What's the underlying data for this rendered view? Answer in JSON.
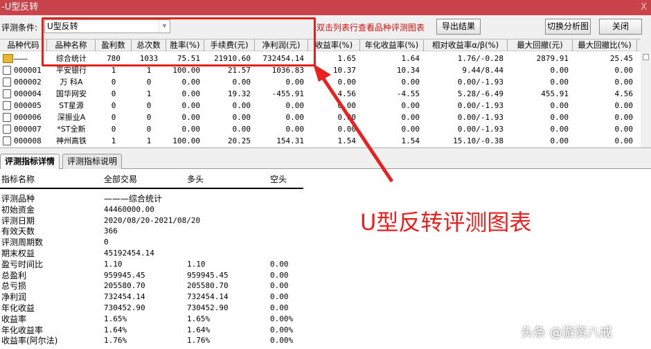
{
  "window": {
    "title": "-U型反转",
    "close": "X"
  },
  "toolbar": {
    "condition_label": "评测条件:",
    "condition_value": "U型反转",
    "hint": "双击列表行查看品种评测图表",
    "export": "导出结果",
    "switch": "切换分析图",
    "close": "关闭"
  },
  "table": {
    "headers": [
      "品种代码",
      "品种名称",
      "盈利数",
      "总次数",
      "胜率(%)",
      "手续费(元)",
      "净利润(元)",
      "收益率(%)",
      "年化收益率(%)",
      "相对收益率α/β(%)",
      "最大回撤(元)",
      "最大回撤比(%)"
    ],
    "rows": [
      [
        "———",
        "综合统计",
        "780",
        "1033",
        "75.51",
        "21910.60",
        "732454.14",
        "1.65",
        "1.64",
        "1.76/-0.28",
        "2879.91",
        "25.45"
      ],
      [
        "000001",
        "平安银行",
        "1",
        "1",
        "100.00",
        "21.57",
        "1036.83",
        "10.37",
        "10.34",
        "9.44/8.44",
        "0.00",
        "0.00"
      ],
      [
        "000002",
        "万 科A",
        "0",
        "0",
        "0.00",
        "0.00",
        "0.00",
        "0.00",
        "0.00",
        "0.00/-1.93",
        "0.00",
        "0.00"
      ],
      [
        "000004",
        "国华网安",
        "0",
        "1",
        "0.00",
        "19.32",
        "-455.91",
        "-4.56",
        "-4.55",
        "5.28/-6.49",
        "455.91",
        "4.56"
      ],
      [
        "000005",
        "ST星源",
        "0",
        "0",
        "0.00",
        "0.00",
        "0.00",
        "0.00",
        "0.00",
        "0.00/-1.93",
        "0.00",
        "0.00"
      ],
      [
        "000006",
        "深振业A",
        "0",
        "0",
        "0.00",
        "0.00",
        "0.00",
        "0.00",
        "0.00",
        "0.00/-1.93",
        "0.00",
        "0.00"
      ],
      [
        "000007",
        "*ST全新",
        "0",
        "0",
        "0.00",
        "0.00",
        "0.00",
        "0.00",
        "0.00",
        "0.00/-1.93",
        "0.00",
        "0.00"
      ],
      [
        "000008",
        "神州高铁",
        "1",
        "1",
        "100.00",
        "20.25",
        "154.31",
        "1.54",
        "1.54",
        "15.10/-0.38",
        "0.00",
        "0.00"
      ]
    ]
  },
  "tabs": [
    "评测指标详情",
    "评测指标说明"
  ],
  "detail": {
    "headers": [
      "指标名称",
      "全部交易",
      "多头",
      "空头"
    ],
    "rows": [
      [
        "评测品种",
        "———综合统计",
        "",
        ""
      ],
      [
        "初始资金",
        "44460000.00",
        "",
        ""
      ],
      [
        "评测日期",
        "2020/08/20-2021/08/20",
        "",
        ""
      ],
      [
        "有效天数",
        "366",
        "",
        ""
      ],
      [
        "评测周期数",
        "0",
        "",
        ""
      ],
      [
        "期末权益",
        "45192454.14",
        "",
        ""
      ],
      [
        "盈亏时间比",
        "1.10",
        "1.10",
        "0.00"
      ],
      [
        "总盈利",
        "959945.45",
        "959945.45",
        "0.00"
      ],
      [
        "总亏损",
        "205580.70",
        "205580.70",
        "0.00"
      ],
      [
        "净利润",
        "732454.14",
        "732454.14",
        "0.00"
      ],
      [
        "年化收益",
        "730452.90",
        "730452.90",
        "0.00"
      ],
      [
        "收益率",
        "1.65%",
        "1.65%",
        "0.00%"
      ],
      [
        "年化收益率",
        "1.64%",
        "1.64%",
        "0.00%"
      ],
      [
        "收益率(阿尔法)",
        "1.76%",
        "1.76%",
        "0.00%"
      ]
    ]
  },
  "annotation": {
    "caption": "U型反转评测图表",
    "color": "#e82020"
  },
  "watermark": "头条 @游资八戒"
}
